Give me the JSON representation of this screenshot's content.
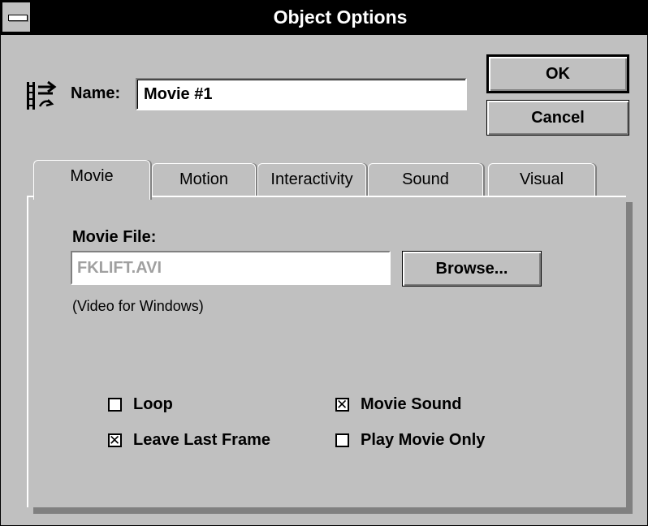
{
  "window": {
    "title": "Object Options"
  },
  "name_row": {
    "label": "Name:",
    "value": "Movie #1"
  },
  "buttons": {
    "ok": "OK",
    "cancel": "Cancel",
    "browse": "Browse..."
  },
  "tabs": [
    "Movie",
    "Motion",
    "Interactivity",
    "Sound",
    "Visual"
  ],
  "active_tab": "Movie",
  "movie": {
    "file_label": "Movie File:",
    "file_value": "FKLIFT.AVI",
    "file_type": "(Video for Windows)"
  },
  "options": [
    {
      "label": "Loop",
      "checked": false
    },
    {
      "label": "Leave Last Frame",
      "checked": true
    },
    {
      "label": "Movie Sound",
      "checked": true
    },
    {
      "label": "Play Movie Only",
      "checked": false
    }
  ],
  "icons": {
    "system_menu": "system-menu-icon",
    "object": "movie-object-icon"
  },
  "colors": {
    "face": "#c0c0c0",
    "titlebar": "#000000",
    "disabled_text": "#a0a0a0"
  }
}
